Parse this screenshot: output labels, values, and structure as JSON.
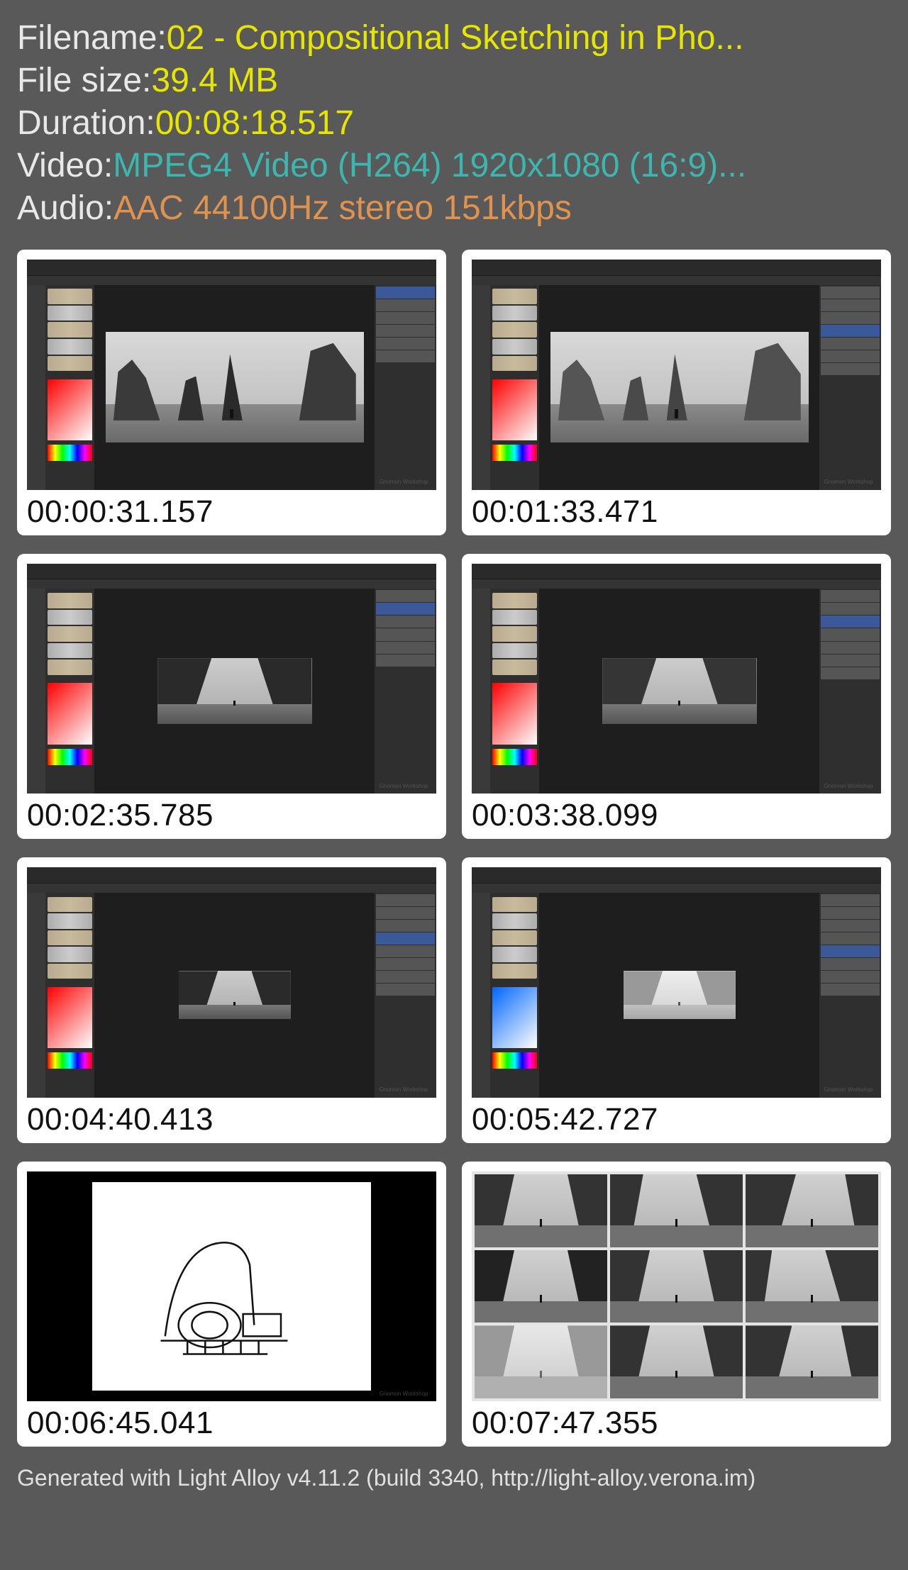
{
  "meta": {
    "filename_label": "Filename: ",
    "filename_value": "02 - Compositional Sketching in Pho...",
    "filesize_label": "File size: ",
    "filesize_value": "39.4 MB",
    "duration_label": "Duration: ",
    "duration_value": "00:08:18.517",
    "video_label": "Video: ",
    "video_value": "MPEG4 Video (H264) 1920x1080 (16:9)...",
    "audio_label": "Audio: ",
    "audio_value": "AAC 44100Hz stereo 151kbps"
  },
  "thumbnails": [
    {
      "timestamp": "00:00:31.157"
    },
    {
      "timestamp": "00:01:33.471"
    },
    {
      "timestamp": "00:02:35.785"
    },
    {
      "timestamp": "00:03:38.099"
    },
    {
      "timestamp": "00:04:40.413"
    },
    {
      "timestamp": "00:05:42.727"
    },
    {
      "timestamp": "00:06:45.041"
    },
    {
      "timestamp": "00:07:47.355"
    }
  ],
  "watermark": "Gnomon Workshop",
  "footer": "Generated with Light Alloy v4.11.2 (build 3340, http://light-alloy.verona.im)"
}
